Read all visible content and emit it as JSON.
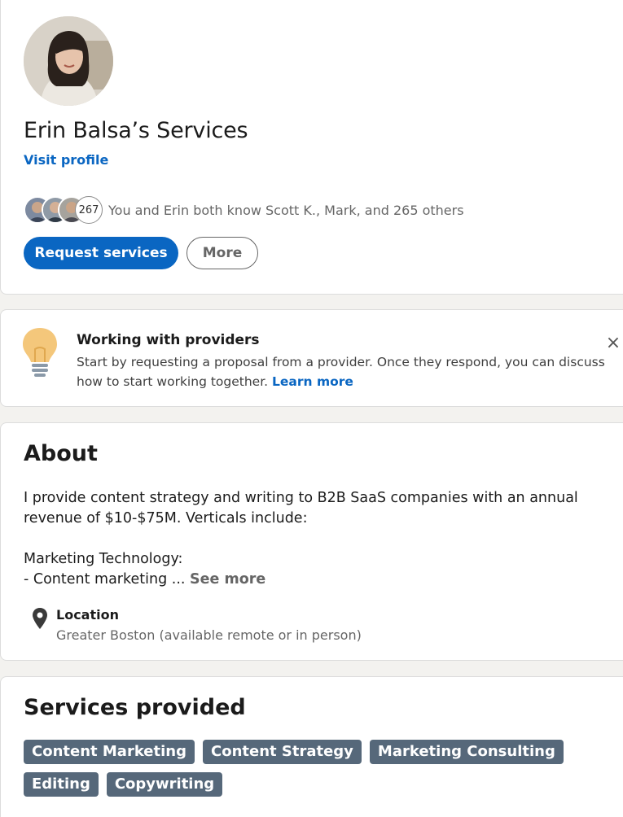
{
  "profile": {
    "name": "Erin Balsa’s Services",
    "visit_profile": "Visit profile",
    "mutual_count": "267",
    "mutual_text": "You and Erin both know Scott K., Mark, and 265 others",
    "request_button": "Request services",
    "more_button": "More"
  },
  "tip": {
    "title": "Working with providers",
    "body": "Start by requesting a proposal from a provider. Once they respond, you can discuss how to start working together.",
    "link": "Learn more",
    "close": "×"
  },
  "about": {
    "title": "About",
    "text": "I provide content strategy and writing to B2B SaaS companies with an annual revenue of $10-$75M. Verticals include:\n\nMarketing Technology:\n- Content marketing ...",
    "see_more": "See more",
    "location_label": "Location",
    "location_value": "Greater Boston (available remote or in person)"
  },
  "services": {
    "title": "Services provided",
    "tags": [
      "Content Marketing",
      "Content Strategy",
      "Marketing Consulting",
      "Editing",
      "Copywriting"
    ]
  },
  "colors": {
    "primary": "#0a66c2",
    "tag_bg": "#56687a",
    "page_bg": "#f3f2ef"
  }
}
